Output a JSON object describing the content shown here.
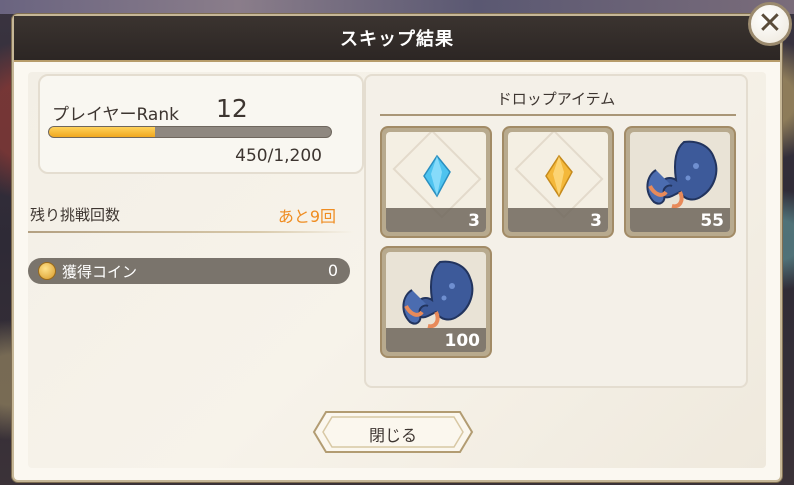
{
  "dialog": {
    "title": "スキップ結果",
    "close_icon": "close-icon"
  },
  "player": {
    "rank_label": "プレイヤーRank",
    "rank_value": "12",
    "exp_text": "450/1,200",
    "exp_progress": 0.375
  },
  "challenges": {
    "label": "残り挑戦回数",
    "value": "あと9回"
  },
  "coins": {
    "label": "獲得コイン",
    "value": "0",
    "icon": "coin-icon"
  },
  "drops": {
    "title": "ドロップアイテム",
    "items": [
      {
        "icon": "blue-crystal-icon",
        "count": "3"
      },
      {
        "icon": "yellow-crystal-icon",
        "count": "3"
      },
      {
        "icon": "crab-claw-icon",
        "count": "55"
      },
      {
        "icon": "crab-claw-icon",
        "count": "100"
      }
    ]
  },
  "footer": {
    "close_label": "閉じる"
  },
  "colors": {
    "accent_orange": "#ef8d22",
    "title_bar": "#2c2624",
    "bar_fill": "#f0a820"
  }
}
